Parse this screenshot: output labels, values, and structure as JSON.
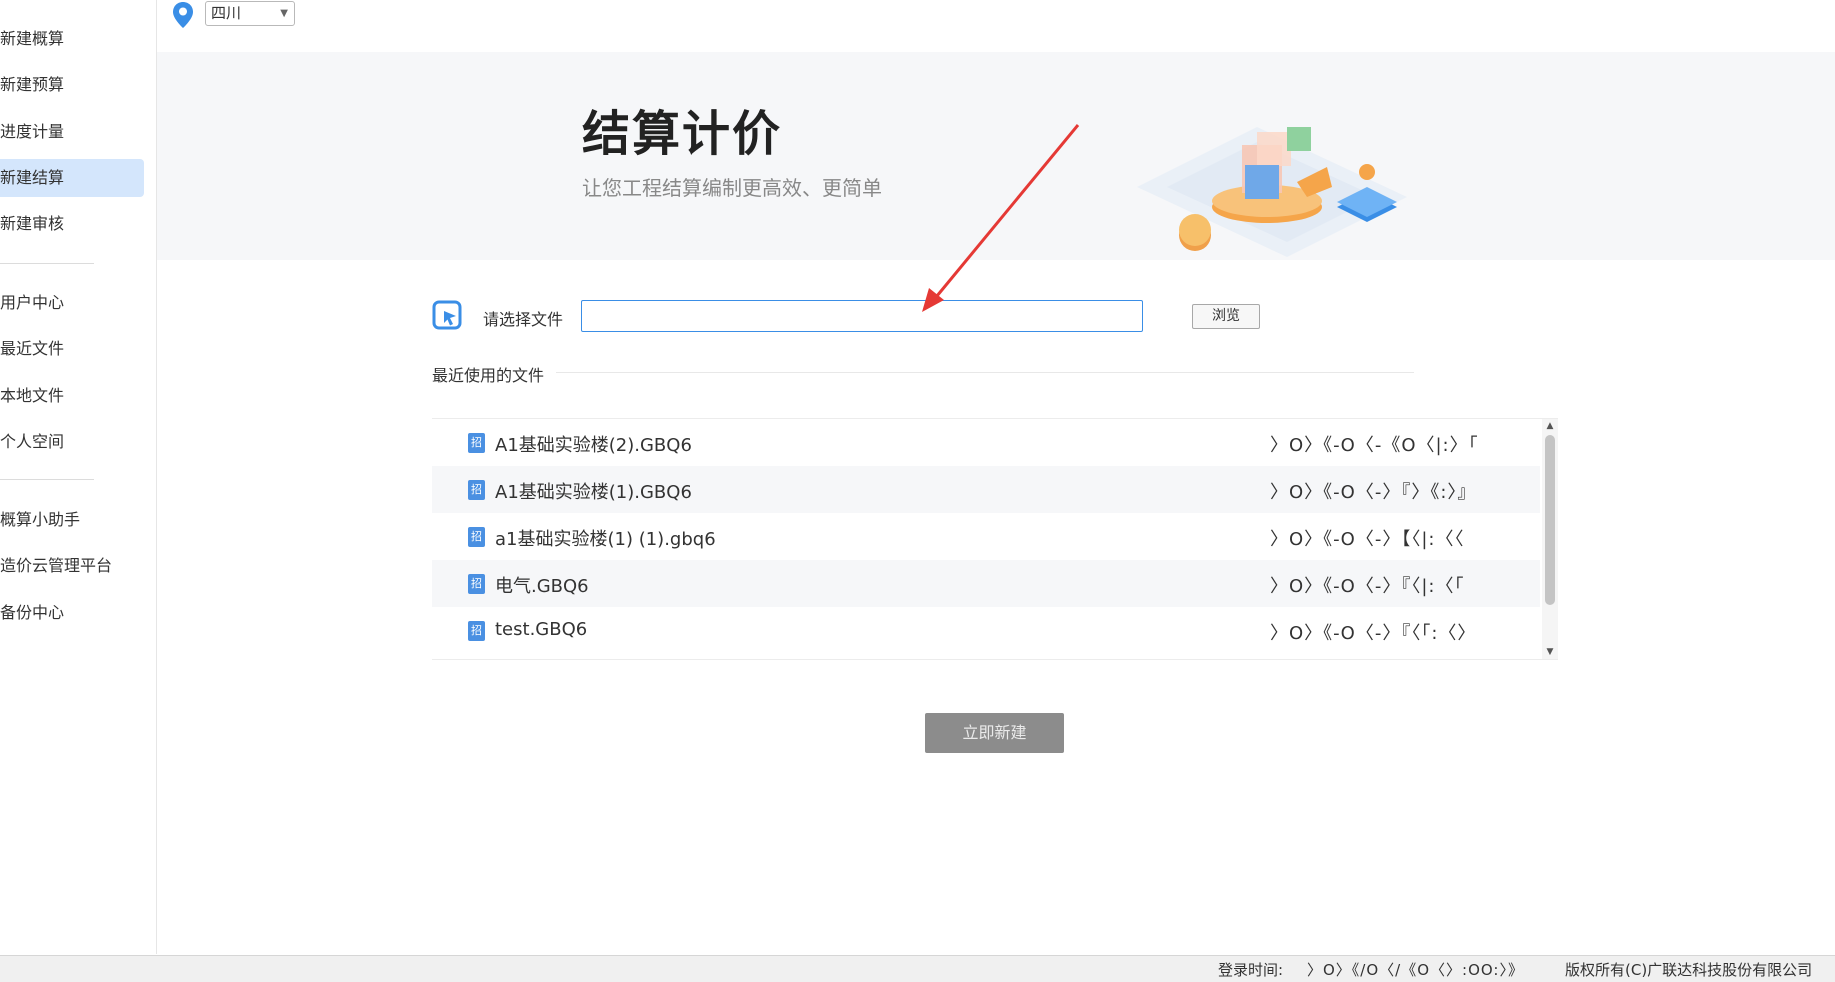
{
  "sidebar": {
    "items": [
      {
        "label": "新建概算",
        "active": false
      },
      {
        "label": "新建预算",
        "active": false
      },
      {
        "label": "进度计量",
        "active": false
      },
      {
        "label": "新建结算",
        "active": true
      },
      {
        "label": "新建审核",
        "active": false
      },
      {
        "label": "用户中心",
        "active": false
      },
      {
        "label": "最近文件",
        "active": false
      },
      {
        "label": "本地文件",
        "active": false
      },
      {
        "label": "个人空间",
        "active": false
      },
      {
        "label": "概算小助手",
        "active": false
      },
      {
        "label": "造价云管理平台",
        "active": false
      },
      {
        "label": "备份中心",
        "active": false
      }
    ]
  },
  "location": {
    "value": "四川"
  },
  "banner": {
    "title": "结算计价",
    "subtitle": "让您工程结算编制更高效、更简单"
  },
  "file_picker": {
    "label": "请选择文件",
    "value": "",
    "browse_label": "浏览"
  },
  "recent": {
    "title": "最近使用的文件",
    "files": [
      {
        "name": "A1基础实验楼(2).GBQ6",
        "time": "〉O〉《-O〈-《O〈|:〉「"
      },
      {
        "name": "A1基础实验楼(1).GBQ6",
        "time": "〉O〉《-O〈-〉『〉《:〉』"
      },
      {
        "name": "a1基础实验楼(1) (1).gbq6",
        "time": "〉O〉《-O〈-〉【〈|:〈〈"
      },
      {
        "name": "电气.GBQ6",
        "time": "〉O〉《-O〈-〉『〈|:〈「"
      },
      {
        "name": "test.GBQ6",
        "time": "〉O〉《-O〈-〉『〈「:〈〉"
      }
    ],
    "file_icon_text": "招"
  },
  "create_button": {
    "label": "立即新建"
  },
  "footer": {
    "login_label": "登录时间:",
    "login_time": "〉O〉《/O〈/《O〈〉:OO:〉》",
    "copyright": "版权所有(C)广联达科技股份有限公司"
  },
  "colors": {
    "accent": "#3a8ee6",
    "active_bg": "#d4e6fc",
    "annotation": "#e53935"
  }
}
